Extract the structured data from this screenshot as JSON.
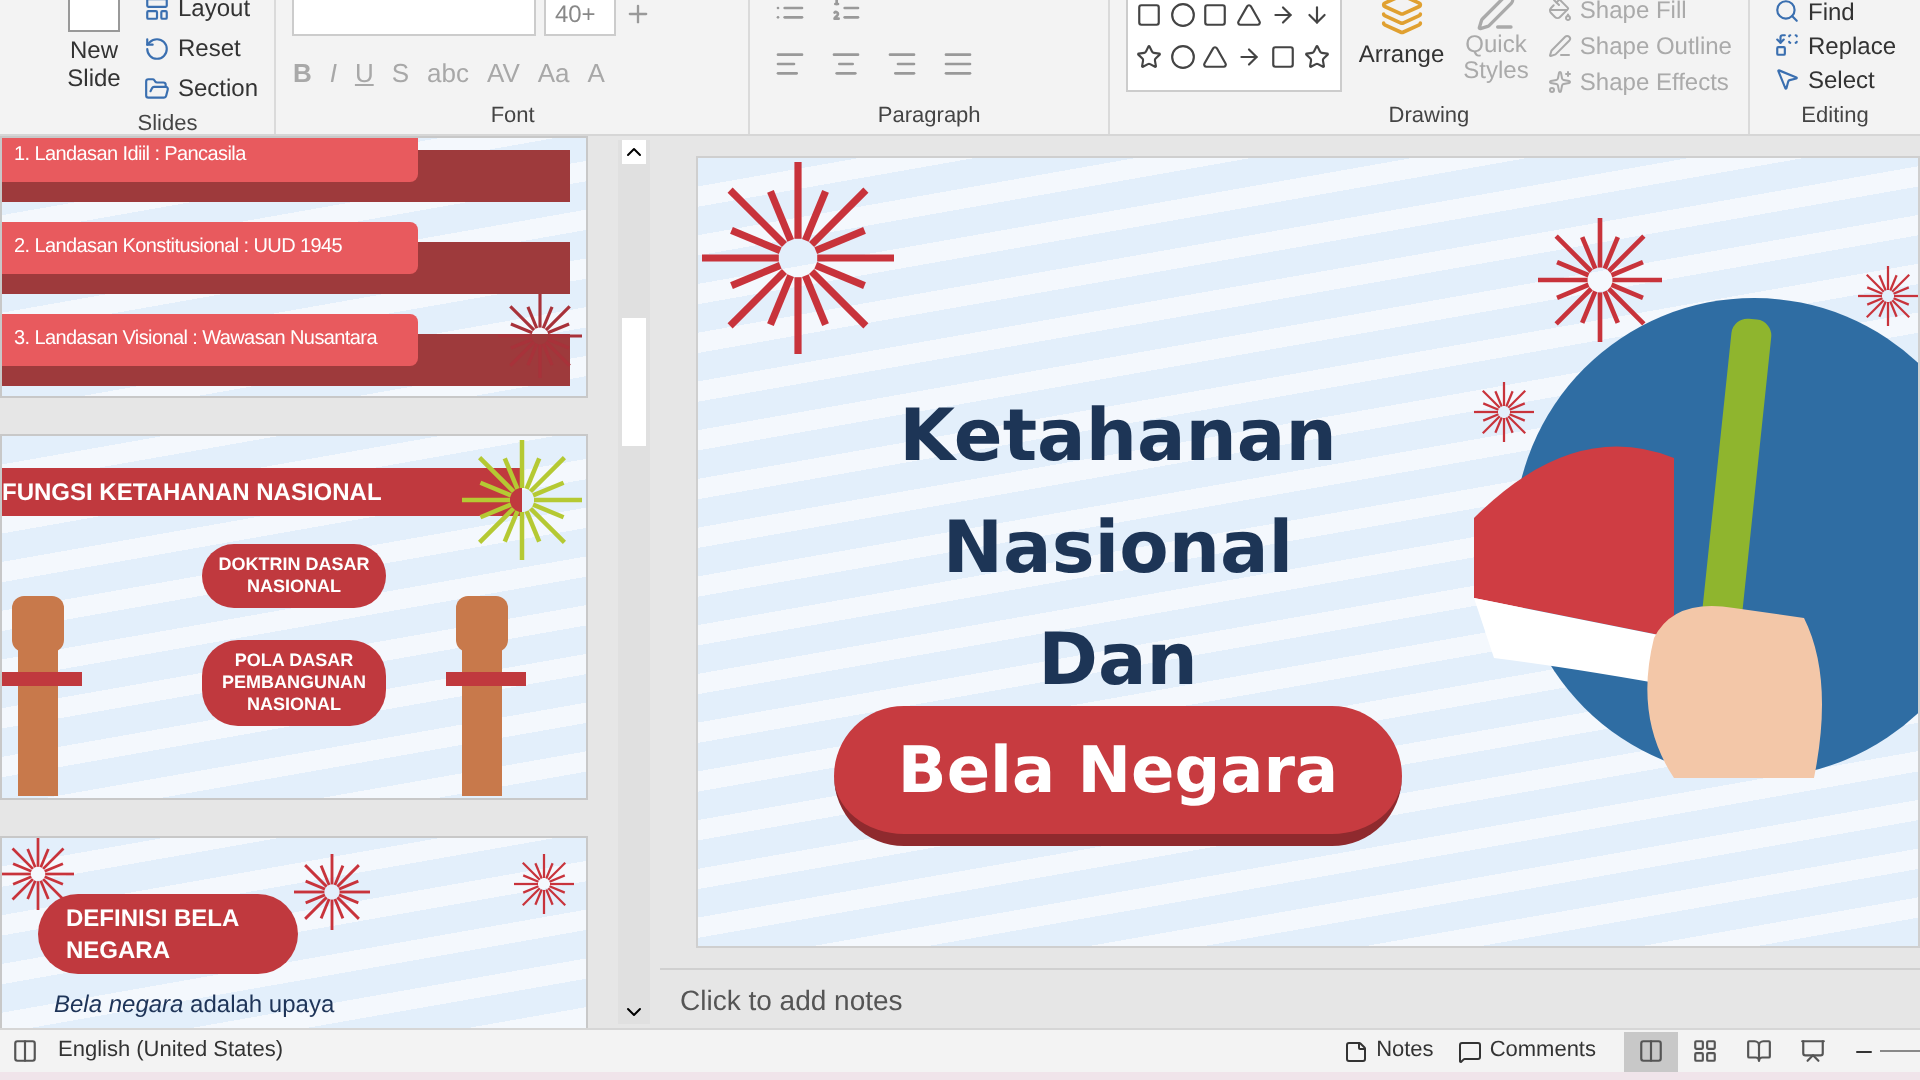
{
  "ribbon": {
    "slides_group": {
      "new_slide": "New Slide",
      "commands": [
        {
          "label": "Layout",
          "kind": "layout"
        },
        {
          "label": "Reset",
          "kind": "reset"
        },
        {
          "label": "Section",
          "kind": "section"
        }
      ],
      "label": "Slides"
    },
    "font_group": {
      "font_size": "40+",
      "format_buttons": [
        {
          "label": "B",
          "disabled": true
        },
        {
          "label": "I",
          "disabled": true
        },
        {
          "label": "U",
          "disabled": true
        },
        {
          "label": "S",
          "disabled": true
        },
        {
          "label": "abc",
          "disabled": true
        },
        {
          "label": "AV",
          "disabled": true
        },
        {
          "label": "Aa",
          "disabled": true
        },
        {
          "label": "A",
          "disabled": true
        }
      ],
      "label": "Font"
    },
    "paragraph_group": {
      "label": "Paragraph"
    },
    "drawing_group": {
      "arrange": {
        "label": "Arrange",
        "disabled": false
      },
      "quick_styles": {
        "label": "Quick Styles",
        "disabled": true
      },
      "shape_commands": [
        {
          "label": "Shape Fill",
          "disabled": true
        },
        {
          "label": "Shape Outline",
          "disabled": true
        },
        {
          "label": "Shape Effects",
          "disabled": true
        }
      ],
      "label": "Drawing"
    },
    "editing_group": {
      "commands": [
        {
          "label": "Find",
          "kind": "find"
        },
        {
          "label": "Replace",
          "kind": "replace"
        },
        {
          "label": "Select",
          "kind": "select"
        }
      ],
      "label": "Editing"
    }
  },
  "thumbnails": [
    {
      "kind": "list",
      "items": [
        "1. Landasan Idiil : Pancasila",
        "2. Landasan Konstitusional : UUD 1945",
        "3. Landasan Visional : Wawasan Nusantara"
      ]
    },
    {
      "kind": "functions",
      "title": "FUNGSI KETAHANAN NASIONAL",
      "pills": [
        "DOKTRIN DASAR NASIONAL",
        "POLA DASAR PEMBANGUNAN NASIONAL"
      ]
    },
    {
      "kind": "definition",
      "title": "DEFINISI BELA NEGARA",
      "text": "*Bela negara* adalah upaya"
    }
  ],
  "slide": {
    "title_lines": [
      "Ketahanan",
      "Nasional",
      "Dan"
    ],
    "banner": "Bela Negara"
  },
  "notes": {
    "placeholder": "Click to add notes"
  },
  "status_bar": {
    "language": "English (United States)",
    "notes": "Notes",
    "comments": "Comments",
    "views": [
      {
        "kind": "normal",
        "selected": true
      },
      {
        "kind": "sorter",
        "selected": false
      },
      {
        "kind": "reading",
        "selected": false
      },
      {
        "kind": "slideshow",
        "selected": false
      }
    ]
  }
}
